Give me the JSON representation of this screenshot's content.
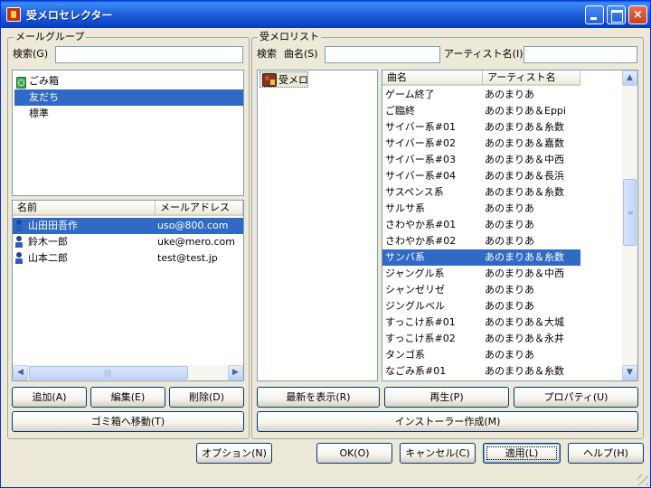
{
  "window": {
    "title": "受メロセレクター",
    "controls": {
      "minimize": "minimize",
      "maximize": "maximize",
      "close": "×"
    }
  },
  "mail_group": {
    "label": "メールグループ",
    "search_label": "検索(G)",
    "search_value": "",
    "groups": [
      {
        "label": "ごみ箱",
        "icon": "trash-icon",
        "selected": false
      },
      {
        "label": "友だち",
        "icon": null,
        "selected": true
      },
      {
        "label": "標準",
        "icon": null,
        "selected": false
      }
    ],
    "contacts": {
      "columns": [
        "名前",
        "メールアドレス"
      ],
      "rows": [
        {
          "name": "山田田吾作",
          "email": "uso@800.com",
          "selected": true
        },
        {
          "name": "鈴木一郎",
          "email": "uke@mero.com",
          "selected": false
        },
        {
          "name": "山本二郎",
          "email": "test@test.jp",
          "selected": false
        }
      ]
    },
    "buttons": {
      "add": "追加(A)",
      "edit": "編集(E)",
      "delete": "削除(D)",
      "move_to_trash": "ゴミ箱へ移動(T)"
    }
  },
  "ringtone_list": {
    "label": "受メロリスト",
    "search_label": "検索",
    "title_label": "曲名(S)",
    "title_value": "",
    "artist_label": "アーティスト名(I)",
    "artist_value": "",
    "tree_root": "受メロ",
    "columns": [
      "曲名",
      "アーティスト名"
    ],
    "songs": [
      {
        "title": "ゲーム終了",
        "artist": "あのまりあ",
        "selected": false
      },
      {
        "title": "ご臨終",
        "artist": "あのまりあ＆Eppi",
        "selected": false
      },
      {
        "title": "サイバー系#01",
        "artist": "あのまりあ＆糸数",
        "selected": false
      },
      {
        "title": "サイバー系#02",
        "artist": "あのまりあ＆嘉数",
        "selected": false
      },
      {
        "title": "サイバー系#03",
        "artist": "あのまりあ＆中西",
        "selected": false
      },
      {
        "title": "サイバー系#04",
        "artist": "あのまりあ＆長浜",
        "selected": false
      },
      {
        "title": "サスペンス系",
        "artist": "あのまりあ＆糸数",
        "selected": false
      },
      {
        "title": "サルサ系",
        "artist": "あのまりあ",
        "selected": false
      },
      {
        "title": "さわやか系#01",
        "artist": "あのまりあ",
        "selected": false
      },
      {
        "title": "さわやか系#02",
        "artist": "あのまりあ",
        "selected": false
      },
      {
        "title": "サンバ系",
        "artist": "あのまりあ＆糸数",
        "selected": true
      },
      {
        "title": "ジャングル系",
        "artist": "あのまりあ＆中西",
        "selected": false
      },
      {
        "title": "シャンゼリゼ",
        "artist": "あのまりあ",
        "selected": false
      },
      {
        "title": "ジングルベル",
        "artist": "あのまりあ",
        "selected": false
      },
      {
        "title": "すっこけ系#01",
        "artist": "あのまりあ＆大城",
        "selected": false
      },
      {
        "title": "すっこけ系#02",
        "artist": "あのまりあ＆永井",
        "selected": false
      },
      {
        "title": "タンゴ系",
        "artist": "あのまりあ",
        "selected": false
      },
      {
        "title": "なごみ系#01",
        "artist": "あのまりあ＆糸数",
        "selected": false
      }
    ],
    "buttons": {
      "show_latest": "最新を表示(R)",
      "play": "再生(P)",
      "properties": "プロパティ(U)",
      "create_installer": "インストーラー作成(M)"
    }
  },
  "footer": {
    "options": "オプション(N)",
    "ok": "OK(O)",
    "cancel": "キャンセル(C)",
    "apply": "適用(L)",
    "help": "ヘルプ(H)"
  },
  "scroll": {
    "up": "▲",
    "down": "▼",
    "left": "◀",
    "right": "▶",
    "grip_v": "≡",
    "grip_h": "|||"
  }
}
